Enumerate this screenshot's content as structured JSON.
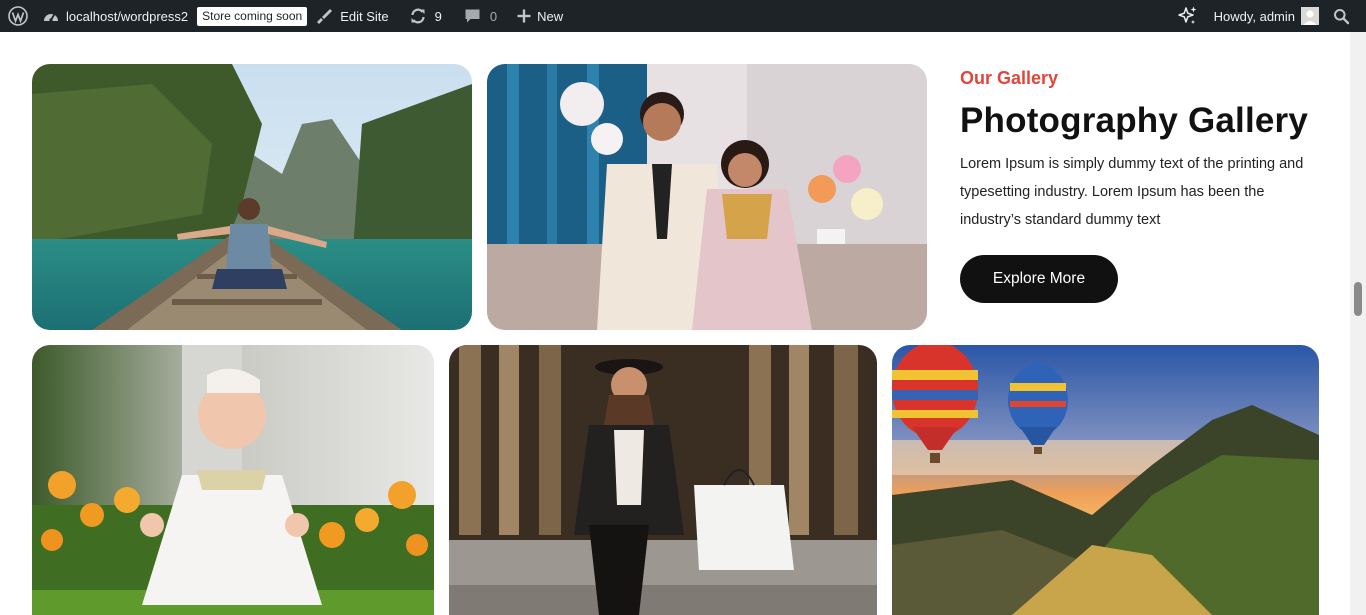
{
  "adminbar": {
    "site_url": "localhost/wordpress2",
    "badge": "Store coming soon",
    "edit_site": "Edit Site",
    "updates_count": "9",
    "comments_count": "0",
    "new_label": "New",
    "howdy": "Howdy, admin"
  },
  "gallery": {
    "eyebrow": "Our Gallery",
    "title": "Photography Gallery",
    "description": "Lorem Ipsum is simply dummy text of the printing and typesetting industry. Lorem Ipsum has been the industry’s standard dummy text",
    "cta_label": "Explore More"
  },
  "photos": [
    {
      "subject": "woman-on-boat"
    },
    {
      "subject": "wedding-couple"
    },
    {
      "subject": "baby-in-flowers"
    },
    {
      "subject": "woman-with-shopping-bag"
    },
    {
      "subject": "hot-air-balloons-mountains"
    }
  ],
  "colors": {
    "adminbar_bg": "#1d2327",
    "accent": "#e2453a",
    "button_bg": "#111111"
  }
}
